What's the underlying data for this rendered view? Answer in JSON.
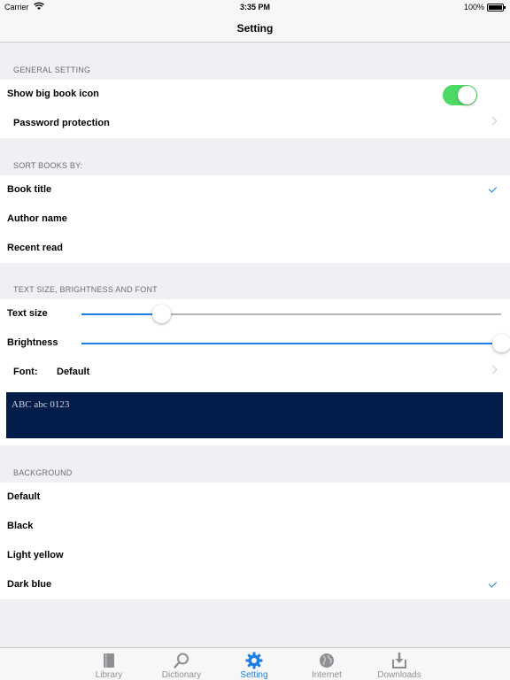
{
  "status_bar": {
    "carrier": "Carrier",
    "time": "3:35 PM",
    "battery": "100%"
  },
  "nav": {
    "title": "Setting"
  },
  "general": {
    "header": "GENERAL SETTING",
    "show_big_icon": "Show big book icon",
    "password": "Password protection"
  },
  "sort": {
    "header": "SORT BOOKS BY:",
    "options": [
      "Book title",
      "Author name",
      "Recent read"
    ],
    "selected": "Book title"
  },
  "text": {
    "header": "TEXT SIZE, BRIGHTNESS AND FONT",
    "text_size_label": "Text size",
    "text_size_value": 0.19,
    "brightness_label": "Brightness",
    "brightness_value": 1.0,
    "font_label": "Font:",
    "font_value": "Default",
    "preview": "ABC abc 0123"
  },
  "background": {
    "header": "BACKGROUND",
    "options": [
      "Default",
      "Black",
      "Light yellow",
      "Dark blue"
    ],
    "selected": "Dark blue"
  },
  "tabs": [
    {
      "label": "Library",
      "icon": "book-icon"
    },
    {
      "label": "Dictionary",
      "icon": "magnifier-icon"
    },
    {
      "label": "Setting",
      "icon": "gear-icon"
    },
    {
      "label": "Internet",
      "icon": "globe-icon"
    },
    {
      "label": "Downloads",
      "icon": "download-icon"
    }
  ],
  "colors": {
    "accent": "#1a7ee6",
    "toggle_on": "#4cd964",
    "preview_bg": "#031d4a"
  }
}
